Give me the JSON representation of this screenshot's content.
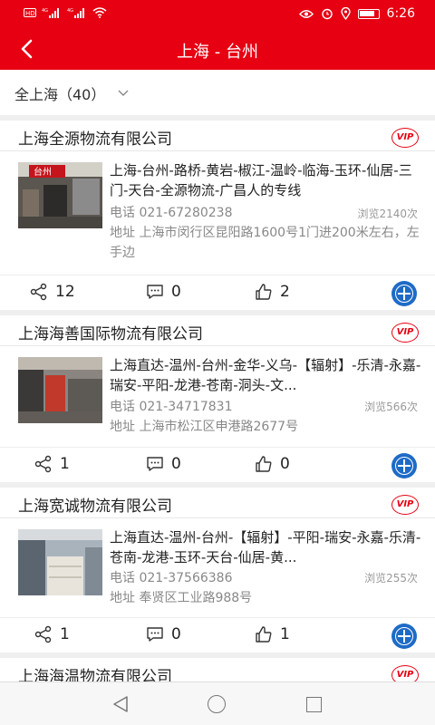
{
  "status_bar": {
    "left_icons": [
      "hd-icon",
      "signal-4g-icon",
      "signal-4g-icon",
      "wifi-icon"
    ],
    "right_icons": [
      "eye-icon",
      "alarm-icon",
      "location-icon",
      "battery-icon"
    ],
    "time": "6:26"
  },
  "header": {
    "title": "上海 - 台州",
    "back_icon": "chevron-left-icon"
  },
  "filter": {
    "label": "全上海（40）",
    "icon": "chevron-down-icon"
  },
  "listings": [
    {
      "company": "上海全源物流有限公司",
      "badge": "VIP",
      "route": "上海-台州-路桥-黄岩-椒江-温岭-临海-玉环-仙居-三门-天台-全源物流-广昌人的专线",
      "phone": "电话 021-67280238",
      "views": "浏览2140次",
      "address": "地址 上海市闵行区昆阳路1600号1门进200米左右，左手边",
      "share_count": "12",
      "comment_count": "0",
      "like_count": "2",
      "thumb_sign": "台州"
    },
    {
      "company": "上海海善国际物流有限公司",
      "badge": "VIP",
      "route": "上海直达-温州-台州-金华-义乌-【辐射】-乐清-永嘉-瑞安-平阳-龙港-苍南-洞头-文...",
      "phone": "电话 021-34717831",
      "views": "浏览566次",
      "address": "地址 上海市松江区申港路2677号",
      "share_count": "1",
      "comment_count": "0",
      "like_count": "0"
    },
    {
      "company": "上海宽诚物流有限公司",
      "badge": "VIP",
      "route": "上海直达-温州-台州-【辐射】-平阳-瑞安-永嘉-乐清-苍南-龙港-玉环-天台-仙居-黄...",
      "phone": "电话 021-37566386",
      "views": "浏览255次",
      "address": "地址 奉贤区工业路988号",
      "share_count": "1",
      "comment_count": "0",
      "like_count": "1"
    },
    {
      "company": "上海海温物流有限公司",
      "badge": "VIP"
    }
  ],
  "nav_bar": {
    "icons": [
      "nav-back-icon",
      "nav-home-icon",
      "nav-recents-icon"
    ]
  },
  "colors": {
    "brand_red": "#e60012",
    "add_blue": "#1e6bc6",
    "muted_text": "#888888"
  }
}
